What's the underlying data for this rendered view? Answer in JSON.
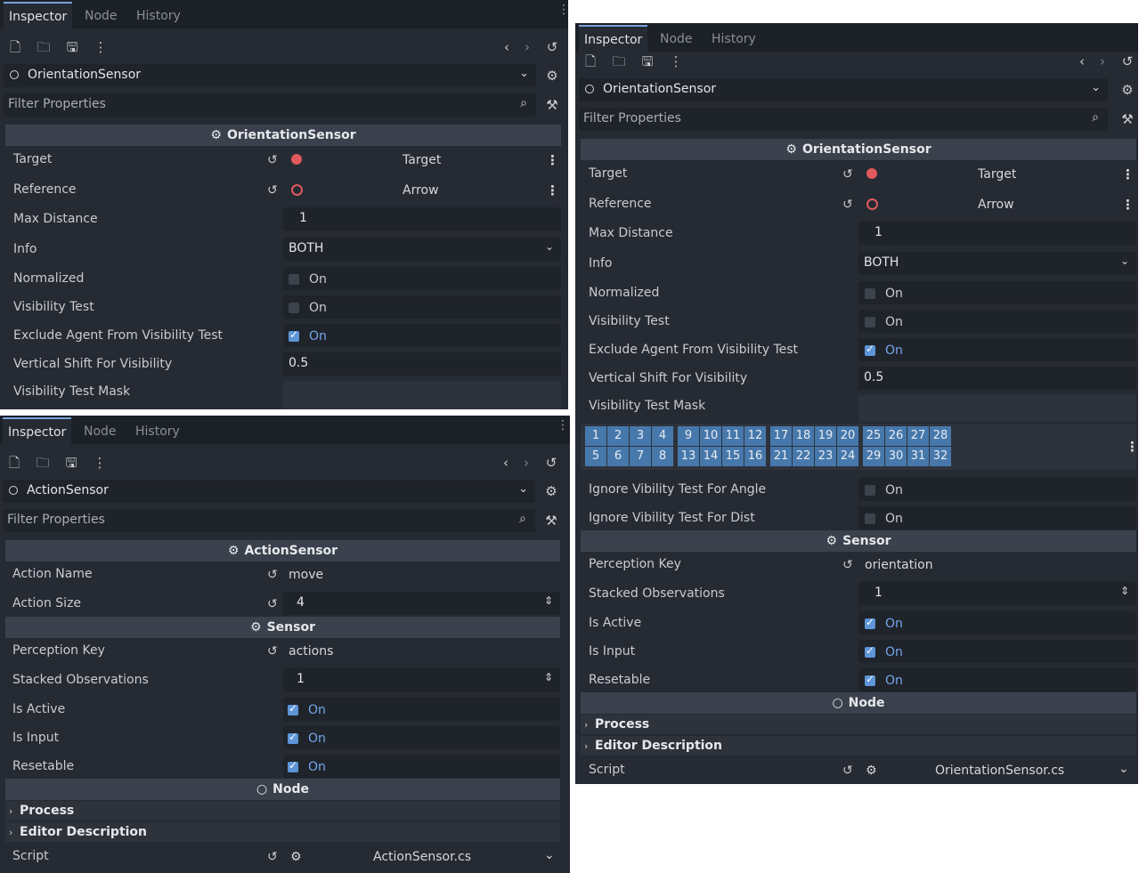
{
  "tabs": [
    "Inspector",
    "Node",
    "History"
  ],
  "filter_placeholder": "Filter Properties",
  "toolbar_icons": [
    "new-resource-icon",
    "open-folder-icon",
    "save-icon",
    "more-icon",
    "back-icon",
    "forward-icon",
    "history-icon"
  ],
  "node_icon": "circle-node-icon",
  "node_section_title": "Node",
  "sensor_section_title": "Sensor",
  "process_label": "Process",
  "editor_description_label": "Editor Description",
  "script_label": "Script",
  "on_label": "On",
  "orientation": {
    "node_name": "OrientationSensor",
    "section_title": "OrientationSensor",
    "target_label": "Target",
    "target_value": "Target",
    "reference_label": "Reference",
    "reference_value": "Arrow",
    "max_distance_label": "Max Distance",
    "max_distance_value": "1",
    "info_label": "Info",
    "info_value": "BOTH",
    "normalized_label": "Normalized",
    "normalized_checked": false,
    "visibility_test_label": "Visibility Test",
    "visibility_test_checked": false,
    "exclude_agent_label": "Exclude Agent From Visibility Test",
    "exclude_agent_checked": true,
    "vertical_shift_label": "Vertical Shift For Visibility",
    "vertical_shift_value": "0.5",
    "visibility_mask_label": "Visibility Test Mask",
    "mask_bits_row1": [
      "1",
      "2",
      "3",
      "4",
      "9",
      "10",
      "11",
      "12",
      "17",
      "18",
      "19",
      "20",
      "25",
      "26",
      "27",
      "28"
    ],
    "mask_bits_row2": [
      "5",
      "6",
      "7",
      "8",
      "13",
      "14",
      "15",
      "16",
      "21",
      "22",
      "23",
      "24",
      "29",
      "30",
      "31",
      "32"
    ],
    "ignore_angle_label": "Ignore Vibility Test For Angle",
    "ignore_dist_label": "Ignore Vibility Test For Dist",
    "perception_key_label": "Perception Key",
    "perception_key_value": "orientation",
    "stacked_label": "Stacked Observations",
    "stacked_value": "1",
    "is_active_label": "Is Active",
    "is_input_label": "Is Input",
    "resetable_label": "Resetable",
    "script_name": "OrientationSensor.cs"
  },
  "action": {
    "node_name": "ActionSensor",
    "section_title": "ActionSensor",
    "action_name_label": "Action Name",
    "action_name_value": "move",
    "action_size_label": "Action Size",
    "action_size_value": "4",
    "perception_key_label": "Perception Key",
    "perception_key_value": "actions",
    "stacked_label": "Stacked Observations",
    "stacked_value": "1",
    "is_active_label": "Is Active",
    "is_input_label": "Is Input",
    "resetable_label": "Resetable",
    "script_name": "ActionSensor.cs"
  },
  "colors": {
    "panel_bg": "#252a33",
    "accent": "#5e95d8",
    "target_icon": "#e0595d",
    "bit_on": "#4778ac"
  }
}
